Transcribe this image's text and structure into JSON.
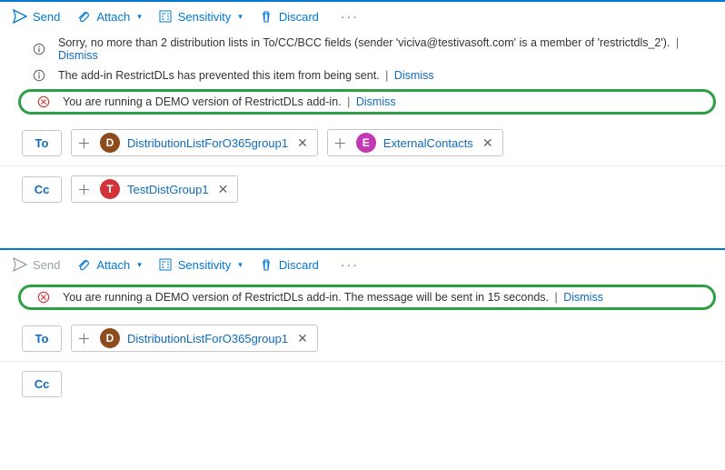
{
  "toolbar": {
    "send": "Send",
    "attach": "Attach",
    "sensitivity": "Sensitivity",
    "discard": "Discard"
  },
  "messages": {
    "m1": "Sorry, no more than 2 distribution lists in To/CC/BCC fields (sender 'viciva@testivasoft.com' is a member of 'restrictdls_2').",
    "m2": "The add-in RestrictDLs has prevented this item from being sent.",
    "m3": "You are running a DEMO version of RestrictDLs add-in.",
    "m4": "You are running a DEMO version of RestrictDLs  add-in. The message will be sent in 15 seconds.",
    "dismiss": "Dismiss"
  },
  "fields": {
    "to": "To",
    "cc": "Cc"
  },
  "recipients": {
    "d_name": "DistributionListForO365group1",
    "d_initial": "D",
    "e_name": "ExternalContacts",
    "e_initial": "E",
    "t_name": "TestDistGroup1",
    "t_initial": "T"
  }
}
